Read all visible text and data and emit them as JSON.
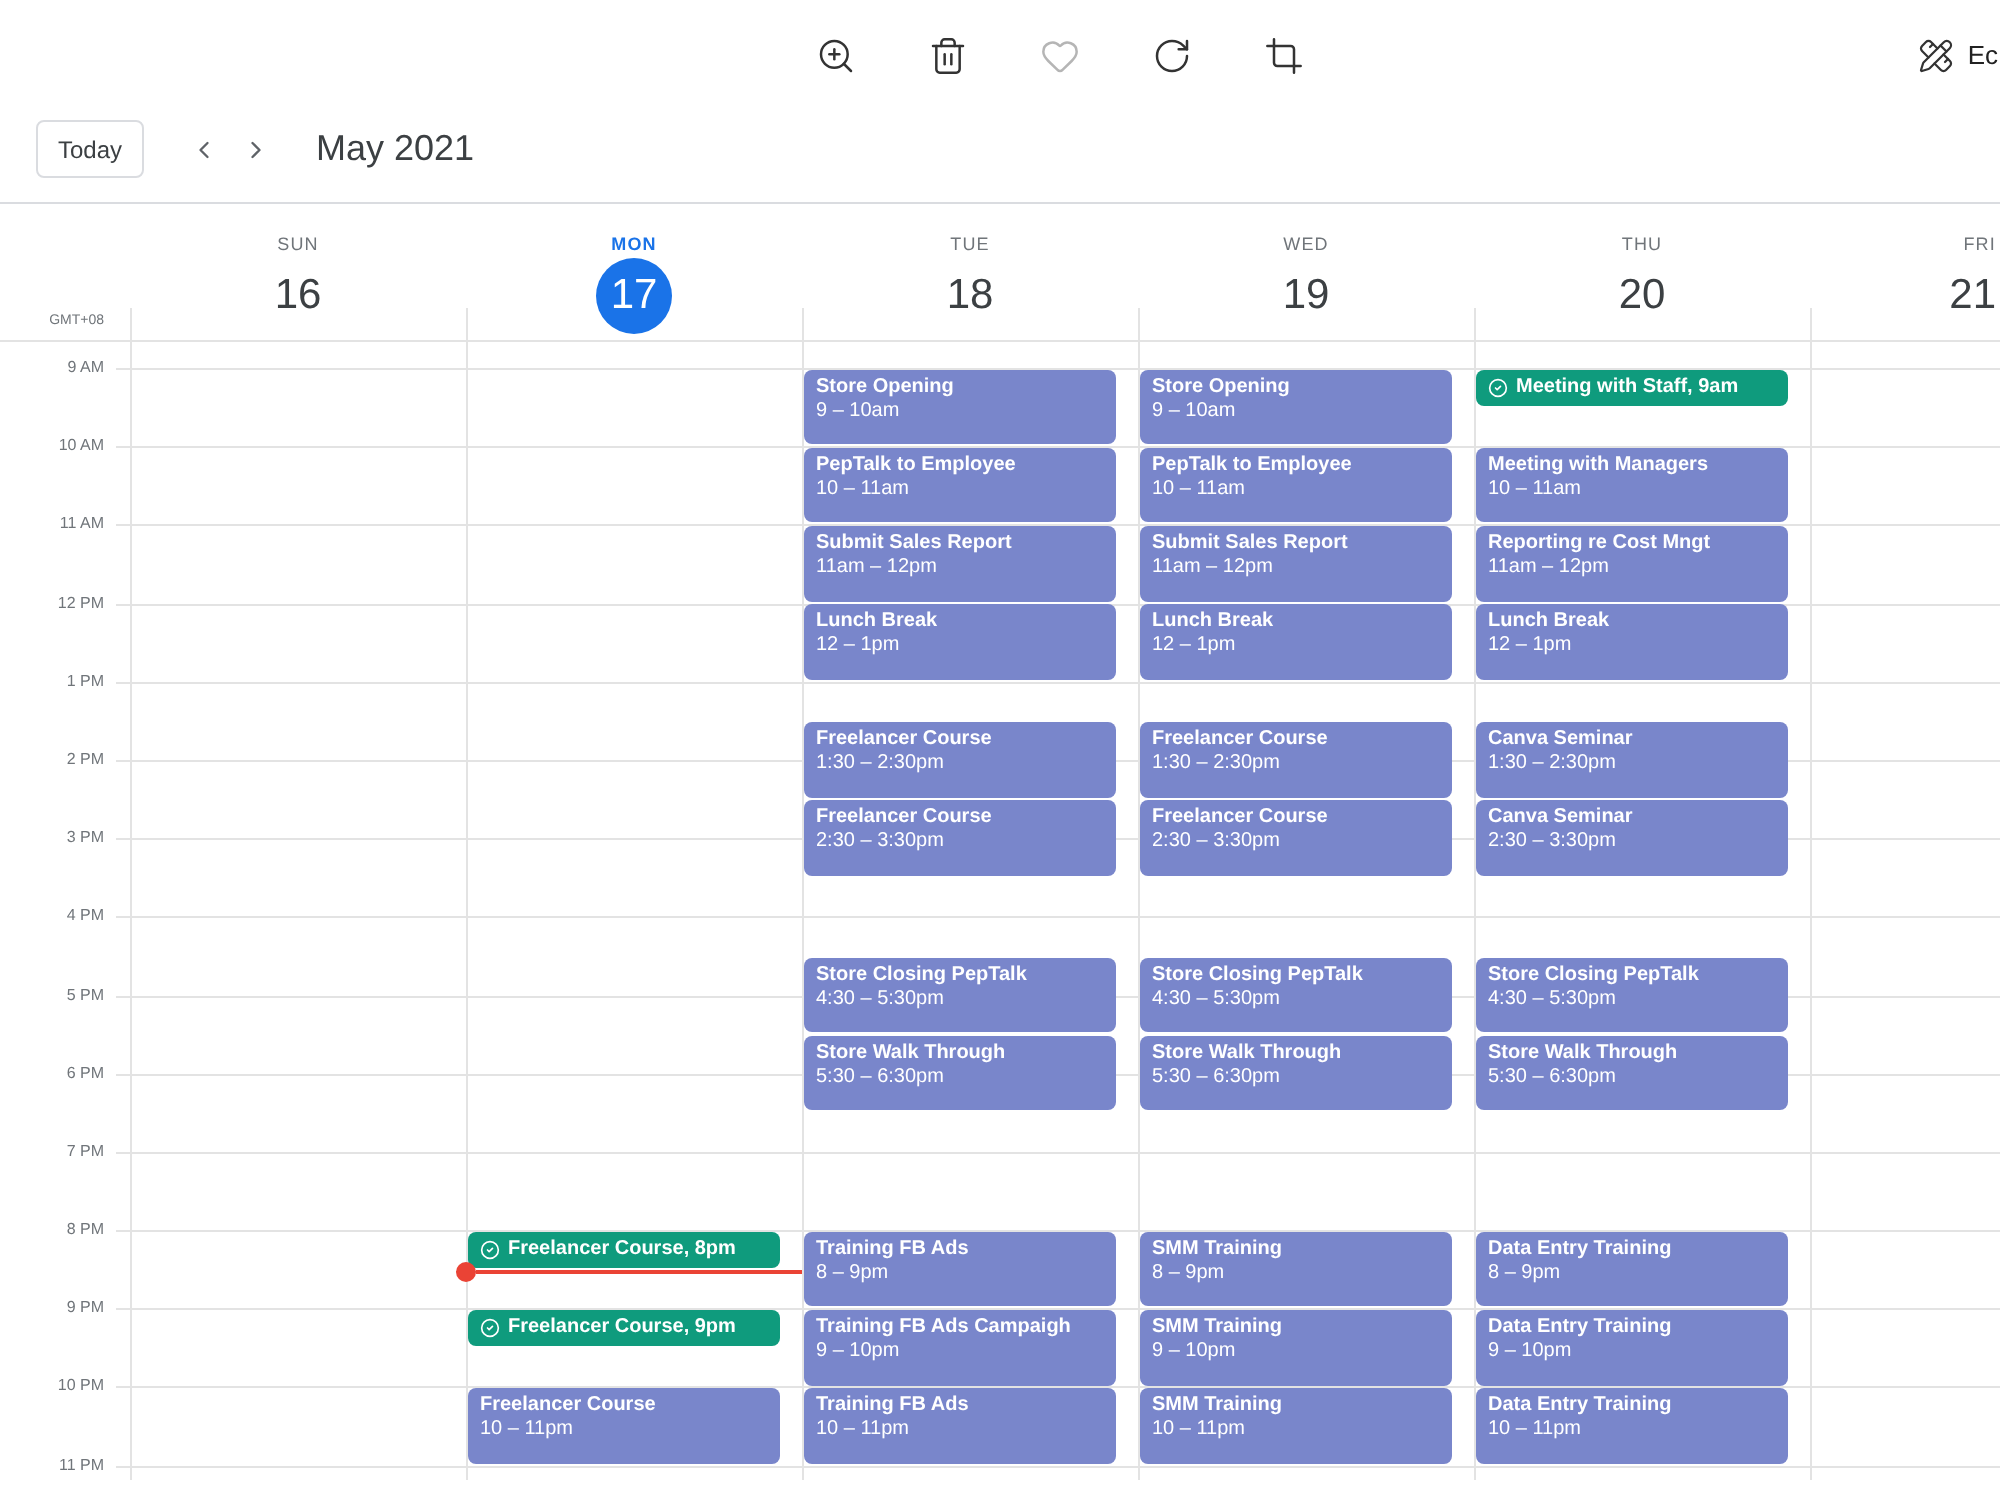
{
  "toolbar": {
    "edit_label": "Ec"
  },
  "header": {
    "today_button": "Today",
    "month": "May 2021"
  },
  "timezone": "GMT+08",
  "hours": [
    "9 AM",
    "10 AM",
    "11 AM",
    "12 PM",
    "1 PM",
    "2 PM",
    "3 PM",
    "4 PM",
    "5 PM",
    "6 PM",
    "7 PM",
    "8 PM",
    "9 PM",
    "10 PM",
    "11 PM"
  ],
  "days": [
    {
      "name": "SUN",
      "date": "16",
      "today": false
    },
    {
      "name": "MON",
      "date": "17",
      "today": true,
      "events": [
        {
          "kind": "task",
          "title": "Freelancer Course, 8pm"
        },
        {
          "kind": "current_time"
        },
        {
          "kind": "task",
          "title": "Freelancer Course, 9pm"
        },
        {
          "kind": "event",
          "title": "Freelancer Course",
          "time": "10 – 11pm"
        }
      ]
    },
    {
      "name": "TUE",
      "date": "18",
      "today": false,
      "events": [
        {
          "kind": "event",
          "title": "Store Opening",
          "time": "9 – 10am"
        },
        {
          "kind": "event",
          "title": "PepTalk to Employee",
          "time": "10 – 11am"
        },
        {
          "kind": "event",
          "title": "Submit Sales Report",
          "time": "11am – 12pm"
        },
        {
          "kind": "event",
          "title": "Lunch Break",
          "time": "12 – 1pm"
        },
        {
          "kind": "event",
          "title": "Freelancer Course",
          "time": "1:30 – 2:30pm"
        },
        {
          "kind": "event",
          "title": "Freelancer Course",
          "time": "2:30 – 3:30pm"
        },
        {
          "kind": "event",
          "title": "Store Closing PepTalk",
          "time": "4:30 – 5:30pm"
        },
        {
          "kind": "event",
          "title": "Store Walk Through",
          "time": "5:30 – 6:30pm"
        },
        {
          "kind": "event",
          "title": "Training FB Ads",
          "time": "8 – 9pm"
        },
        {
          "kind": "event",
          "title": "Training FB Ads Campaigh",
          "time": "9 – 10pm"
        },
        {
          "kind": "event",
          "title": "Training FB Ads",
          "time": "10 – 11pm"
        }
      ]
    },
    {
      "name": "WED",
      "date": "19",
      "today": false,
      "events": [
        {
          "kind": "event",
          "title": "Store Opening",
          "time": "9 – 10am"
        },
        {
          "kind": "event",
          "title": "PepTalk to Employee",
          "time": "10 – 11am"
        },
        {
          "kind": "event",
          "title": "Submit Sales Report",
          "time": "11am – 12pm"
        },
        {
          "kind": "event",
          "title": "Lunch Break",
          "time": "12 – 1pm"
        },
        {
          "kind": "event",
          "title": "Freelancer Course",
          "time": "1:30 – 2:30pm"
        },
        {
          "kind": "event",
          "title": "Freelancer Course",
          "time": "2:30 – 3:30pm"
        },
        {
          "kind": "event",
          "title": "Store Closing PepTalk",
          "time": "4:30 – 5:30pm"
        },
        {
          "kind": "event",
          "title": "Store Walk Through",
          "time": "5:30 – 6:30pm"
        },
        {
          "kind": "event",
          "title": "SMM Training",
          "time": "8 – 9pm"
        },
        {
          "kind": "event",
          "title": "SMM Training",
          "time": "9 – 10pm"
        },
        {
          "kind": "event",
          "title": "SMM Training",
          "time": "10 – 11pm"
        }
      ]
    },
    {
      "name": "THU",
      "date": "20",
      "today": false,
      "events": [
        {
          "kind": "task",
          "title": "Meeting with Staff, 9am"
        },
        {
          "kind": "event",
          "title": "Meeting with Managers",
          "time": "10 – 11am"
        },
        {
          "kind": "event",
          "title": "Reporting re Cost Mngt",
          "time": "11am – 12pm"
        },
        {
          "kind": "event",
          "title": "Lunch Break",
          "time": "12 – 1pm"
        },
        {
          "kind": "event",
          "title": "Canva Seminar",
          "time": "1:30 – 2:30pm"
        },
        {
          "kind": "event",
          "title": "Canva Seminar",
          "time": "2:30 – 3:30pm"
        },
        {
          "kind": "event",
          "title": "Store Closing PepTalk",
          "time": "4:30 – 5:30pm"
        },
        {
          "kind": "event",
          "title": "Store Walk Through",
          "time": "5:30 – 6:30pm"
        },
        {
          "kind": "event",
          "title": "Data Entry Training",
          "time": "8 – 9pm"
        },
        {
          "kind": "event",
          "title": "Data Entry Training",
          "time": "9 – 10pm"
        },
        {
          "kind": "event",
          "title": "Data Entry Training",
          "time": "10 – 11pm"
        }
      ]
    },
    {
      "name": "FRI",
      "date": "21",
      "today": false
    }
  ]
}
